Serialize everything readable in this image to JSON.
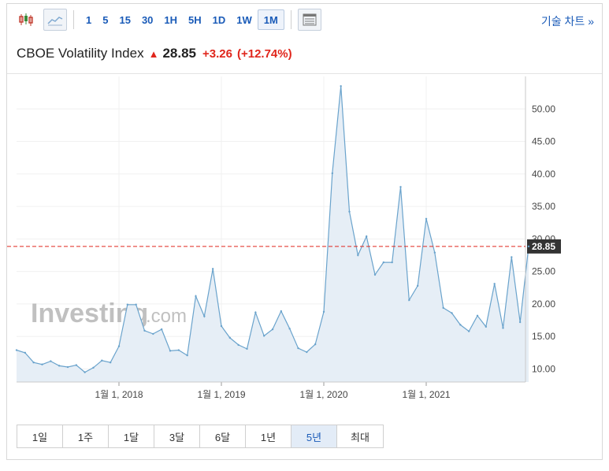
{
  "toolbar": {
    "icons": [
      "candlestick-chart-icon",
      "area-chart-icon",
      "indicator-table-icon"
    ],
    "periods": [
      "1",
      "5",
      "15",
      "30",
      "1H",
      "5H",
      "1D",
      "1W",
      "1M"
    ],
    "active_period": "1M",
    "tech_chart_link": "기술 차트 »"
  },
  "header": {
    "name": "CBOE Volatility Index",
    "price": "28.85",
    "change": "+3.26",
    "change_pct": "(+12.74%)",
    "direction": "up"
  },
  "watermark": {
    "brand": "Investing",
    "suffix": ".com"
  },
  "ranges": {
    "items": [
      "1일",
      "1주",
      "1달",
      "3달",
      "6달",
      "1년",
      "5년",
      "최대"
    ],
    "active": "5년"
  },
  "colors": {
    "accent": "#1a5bb8",
    "up": "#e0261c",
    "line": "#6aa3cc",
    "fill": "#e6eef6",
    "last_price_bg": "#333333"
  },
  "chart_data": {
    "type": "area",
    "x_tick_labels": [
      "1월 1, 2018",
      "1월 1, 2019",
      "1월 1, 2020",
      "1월 1, 2021"
    ],
    "y_tick_labels": [
      "10.00",
      "15.00",
      "20.00",
      "25.00",
      "30.00",
      "35.00",
      "40.00",
      "45.00",
      "50.00"
    ],
    "ylim": [
      8,
      55
    ],
    "grid": true,
    "x": [
      "2017-01",
      "2017-02",
      "2017-03",
      "2017-04",
      "2017-05",
      "2017-06",
      "2017-07",
      "2017-08",
      "2017-09",
      "2017-10",
      "2017-11",
      "2017-12",
      "2018-01",
      "2018-02",
      "2018-03",
      "2018-04",
      "2018-05",
      "2018-06",
      "2018-07",
      "2018-08",
      "2018-09",
      "2018-10",
      "2018-11",
      "2018-12",
      "2019-01",
      "2019-02",
      "2019-03",
      "2019-04",
      "2019-05",
      "2019-06",
      "2019-07",
      "2019-08",
      "2019-09",
      "2019-10",
      "2019-11",
      "2019-12",
      "2020-01",
      "2020-02",
      "2020-03",
      "2020-04",
      "2020-05",
      "2020-06",
      "2020-07",
      "2020-08",
      "2020-09",
      "2020-10",
      "2020-11",
      "2020-12",
      "2021-01",
      "2021-02",
      "2021-03",
      "2021-04",
      "2021-05",
      "2021-06",
      "2021-07",
      "2021-08",
      "2021-09",
      "2021-10",
      "2021-11",
      "2021-12",
      "2022-01"
    ],
    "values": [
      12.9,
      12.5,
      11.0,
      10.7,
      11.2,
      10.5,
      10.3,
      10.6,
      9.5,
      10.2,
      11.3,
      11.0,
      13.5,
      19.9,
      19.9,
      15.9,
      15.4,
      16.1,
      12.8,
      12.9,
      12.1,
      21.2,
      18.1,
      25.4,
      16.6,
      14.8,
      13.7,
      13.1,
      18.7,
      15.1,
      16.1,
      18.9,
      16.2,
      13.2,
      12.6,
      13.8,
      18.8,
      40.1,
      53.5,
      34.2,
      27.5,
      30.4,
      24.5,
      26.4,
      26.4,
      38.0,
      20.6,
      22.8,
      33.1,
      27.9,
      19.4,
      18.6,
      16.8,
      15.8,
      18.2,
      16.5,
      23.1,
      16.3,
      27.2,
      17.2,
      28.85
    ]
  },
  "last_price_label": "28.85"
}
